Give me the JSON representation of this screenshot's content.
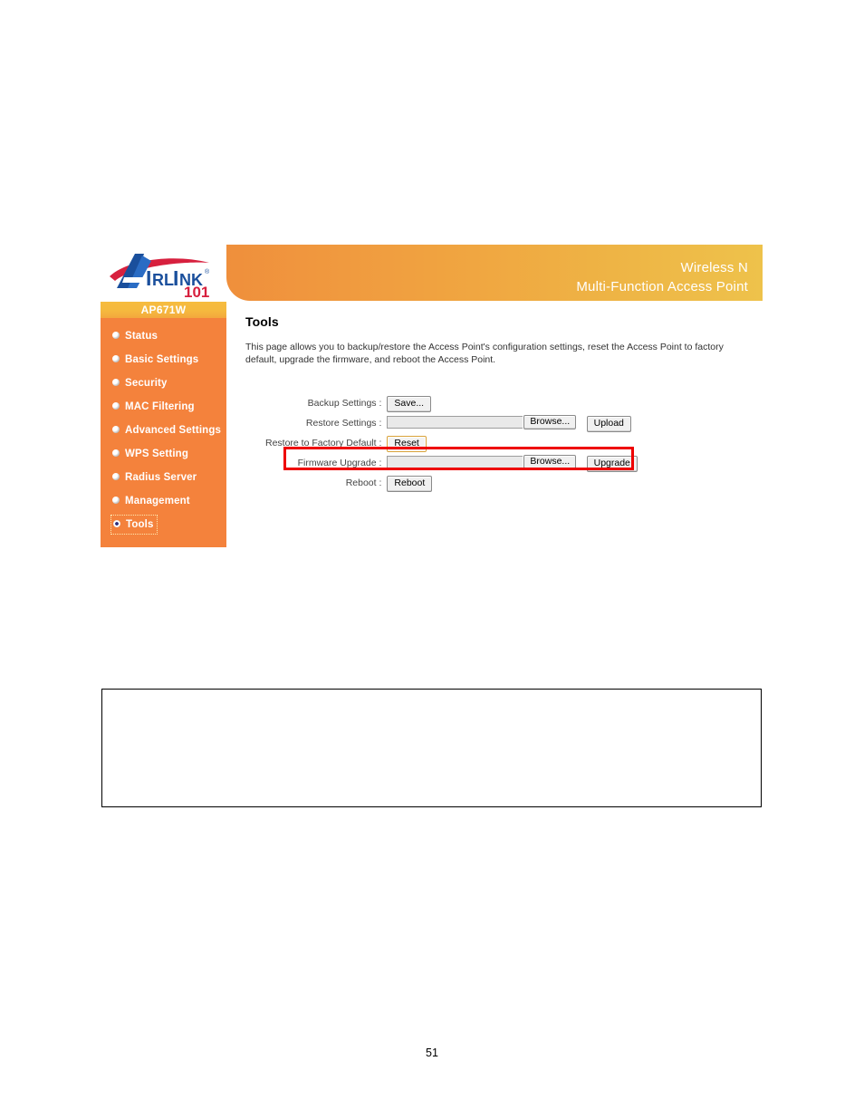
{
  "document": {
    "page_number": "51"
  },
  "brand": {
    "logo_primary": "AIRLINK",
    "logo_suffix": "101",
    "logo_registered": "®"
  },
  "header": {
    "line1": "Wireless N",
    "line2": "Multi-Function Access Point",
    "gradient_left": "#ef8f3c",
    "gradient_right": "#eec24b"
  },
  "sidebar": {
    "model_title": "AP671W",
    "background": "#f4823c",
    "title_background": "#f5b93e",
    "items": [
      {
        "label": "Status",
        "selected": false
      },
      {
        "label": "Basic Settings",
        "selected": false
      },
      {
        "label": "Security",
        "selected": false
      },
      {
        "label": "MAC Filtering",
        "selected": false
      },
      {
        "label": "Advanced Settings",
        "selected": false
      },
      {
        "label": "WPS Setting",
        "selected": false
      },
      {
        "label": "Radius Server",
        "selected": false
      },
      {
        "label": "Management",
        "selected": false
      },
      {
        "label": "Tools",
        "selected": true
      }
    ]
  },
  "main": {
    "title": "Tools",
    "description": "This page allows you to backup/restore the Access Point's configuration settings, reset the Access Point to factory default, upgrade the firmware, and reboot the Access Point.",
    "rows": [
      {
        "label": "Backup Settings :",
        "type": "button",
        "button_label": "Save...",
        "highlighted_button": false
      },
      {
        "label": "Restore Settings :",
        "type": "file",
        "file_value": "",
        "browse_label": "Browse...",
        "action_label": "Upload"
      },
      {
        "label": "Restore to Factory Default :",
        "type": "button",
        "button_label": "Reset",
        "highlighted_button": true
      },
      {
        "label": "Firmware Upgrade :",
        "type": "file",
        "file_value": "",
        "browse_label": "Browse...",
        "action_label": "Upgrade"
      },
      {
        "label": "Reboot :",
        "type": "button",
        "button_label": "Reboot",
        "highlighted_button": false
      }
    ]
  },
  "annotation": {
    "highlight_color": "#ee0000",
    "highlight_target": "Firmware Upgrade row"
  },
  "note_box": {
    "text": ""
  }
}
